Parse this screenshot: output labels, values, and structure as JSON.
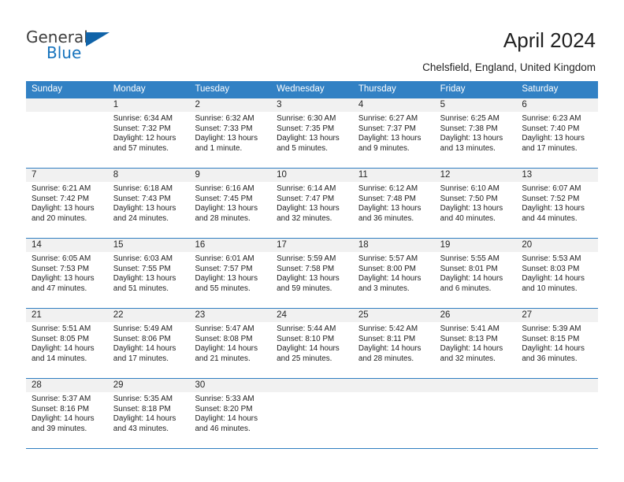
{
  "brand": {
    "name_part1": "General",
    "name_part2": "Blue",
    "triangle_color": "#1063a8",
    "blue_color": "#1673bd"
  },
  "header": {
    "title": "April 2024",
    "subtitle": "Chelsfield, England, United Kingdom"
  },
  "theme": {
    "header_bar_color": "#3281c4",
    "day_band_color": "#f1f1f1",
    "rule_color": "#2f7dc0"
  },
  "weekdays": [
    "Sunday",
    "Monday",
    "Tuesday",
    "Wednesday",
    "Thursday",
    "Friday",
    "Saturday"
  ],
  "weeks": [
    [
      {
        "day": "",
        "sunrise": "",
        "sunset": "",
        "daylight": ""
      },
      {
        "day": "1",
        "sunrise": "Sunrise: 6:34 AM",
        "sunset": "Sunset: 7:32 PM",
        "daylight": "Daylight: 12 hours and 57 minutes."
      },
      {
        "day": "2",
        "sunrise": "Sunrise: 6:32 AM",
        "sunset": "Sunset: 7:33 PM",
        "daylight": "Daylight: 13 hours and 1 minute."
      },
      {
        "day": "3",
        "sunrise": "Sunrise: 6:30 AM",
        "sunset": "Sunset: 7:35 PM",
        "daylight": "Daylight: 13 hours and 5 minutes."
      },
      {
        "day": "4",
        "sunrise": "Sunrise: 6:27 AM",
        "sunset": "Sunset: 7:37 PM",
        "daylight": "Daylight: 13 hours and 9 minutes."
      },
      {
        "day": "5",
        "sunrise": "Sunrise: 6:25 AM",
        "sunset": "Sunset: 7:38 PM",
        "daylight": "Daylight: 13 hours and 13 minutes."
      },
      {
        "day": "6",
        "sunrise": "Sunrise: 6:23 AM",
        "sunset": "Sunset: 7:40 PM",
        "daylight": "Daylight: 13 hours and 17 minutes."
      }
    ],
    [
      {
        "day": "7",
        "sunrise": "Sunrise: 6:21 AM",
        "sunset": "Sunset: 7:42 PM",
        "daylight": "Daylight: 13 hours and 20 minutes."
      },
      {
        "day": "8",
        "sunrise": "Sunrise: 6:18 AM",
        "sunset": "Sunset: 7:43 PM",
        "daylight": "Daylight: 13 hours and 24 minutes."
      },
      {
        "day": "9",
        "sunrise": "Sunrise: 6:16 AM",
        "sunset": "Sunset: 7:45 PM",
        "daylight": "Daylight: 13 hours and 28 minutes."
      },
      {
        "day": "10",
        "sunrise": "Sunrise: 6:14 AM",
        "sunset": "Sunset: 7:47 PM",
        "daylight": "Daylight: 13 hours and 32 minutes."
      },
      {
        "day": "11",
        "sunrise": "Sunrise: 6:12 AM",
        "sunset": "Sunset: 7:48 PM",
        "daylight": "Daylight: 13 hours and 36 minutes."
      },
      {
        "day": "12",
        "sunrise": "Sunrise: 6:10 AM",
        "sunset": "Sunset: 7:50 PM",
        "daylight": "Daylight: 13 hours and 40 minutes."
      },
      {
        "day": "13",
        "sunrise": "Sunrise: 6:07 AM",
        "sunset": "Sunset: 7:52 PM",
        "daylight": "Daylight: 13 hours and 44 minutes."
      }
    ],
    [
      {
        "day": "14",
        "sunrise": "Sunrise: 6:05 AM",
        "sunset": "Sunset: 7:53 PM",
        "daylight": "Daylight: 13 hours and 47 minutes."
      },
      {
        "day": "15",
        "sunrise": "Sunrise: 6:03 AM",
        "sunset": "Sunset: 7:55 PM",
        "daylight": "Daylight: 13 hours and 51 minutes."
      },
      {
        "day": "16",
        "sunrise": "Sunrise: 6:01 AM",
        "sunset": "Sunset: 7:57 PM",
        "daylight": "Daylight: 13 hours and 55 minutes."
      },
      {
        "day": "17",
        "sunrise": "Sunrise: 5:59 AM",
        "sunset": "Sunset: 7:58 PM",
        "daylight": "Daylight: 13 hours and 59 minutes."
      },
      {
        "day": "18",
        "sunrise": "Sunrise: 5:57 AM",
        "sunset": "Sunset: 8:00 PM",
        "daylight": "Daylight: 14 hours and 3 minutes."
      },
      {
        "day": "19",
        "sunrise": "Sunrise: 5:55 AM",
        "sunset": "Sunset: 8:01 PM",
        "daylight": "Daylight: 14 hours and 6 minutes."
      },
      {
        "day": "20",
        "sunrise": "Sunrise: 5:53 AM",
        "sunset": "Sunset: 8:03 PM",
        "daylight": "Daylight: 14 hours and 10 minutes."
      }
    ],
    [
      {
        "day": "21",
        "sunrise": "Sunrise: 5:51 AM",
        "sunset": "Sunset: 8:05 PM",
        "daylight": "Daylight: 14 hours and 14 minutes."
      },
      {
        "day": "22",
        "sunrise": "Sunrise: 5:49 AM",
        "sunset": "Sunset: 8:06 PM",
        "daylight": "Daylight: 14 hours and 17 minutes."
      },
      {
        "day": "23",
        "sunrise": "Sunrise: 5:47 AM",
        "sunset": "Sunset: 8:08 PM",
        "daylight": "Daylight: 14 hours and 21 minutes."
      },
      {
        "day": "24",
        "sunrise": "Sunrise: 5:44 AM",
        "sunset": "Sunset: 8:10 PM",
        "daylight": "Daylight: 14 hours and 25 minutes."
      },
      {
        "day": "25",
        "sunrise": "Sunrise: 5:42 AM",
        "sunset": "Sunset: 8:11 PM",
        "daylight": "Daylight: 14 hours and 28 minutes."
      },
      {
        "day": "26",
        "sunrise": "Sunrise: 5:41 AM",
        "sunset": "Sunset: 8:13 PM",
        "daylight": "Daylight: 14 hours and 32 minutes."
      },
      {
        "day": "27",
        "sunrise": "Sunrise: 5:39 AM",
        "sunset": "Sunset: 8:15 PM",
        "daylight": "Daylight: 14 hours and 36 minutes."
      }
    ],
    [
      {
        "day": "28",
        "sunrise": "Sunrise: 5:37 AM",
        "sunset": "Sunset: 8:16 PM",
        "daylight": "Daylight: 14 hours and 39 minutes."
      },
      {
        "day": "29",
        "sunrise": "Sunrise: 5:35 AM",
        "sunset": "Sunset: 8:18 PM",
        "daylight": "Daylight: 14 hours and 43 minutes."
      },
      {
        "day": "30",
        "sunrise": "Sunrise: 5:33 AM",
        "sunset": "Sunset: 8:20 PM",
        "daylight": "Daylight: 14 hours and 46 minutes."
      },
      {
        "day": "",
        "sunrise": "",
        "sunset": "",
        "daylight": ""
      },
      {
        "day": "",
        "sunrise": "",
        "sunset": "",
        "daylight": ""
      },
      {
        "day": "",
        "sunrise": "",
        "sunset": "",
        "daylight": ""
      },
      {
        "day": "",
        "sunrise": "",
        "sunset": "",
        "daylight": ""
      }
    ]
  ]
}
